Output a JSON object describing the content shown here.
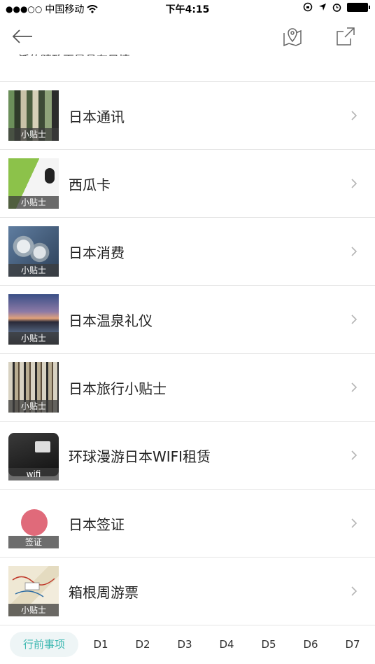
{
  "status_bar": {
    "signal": "●●●○○",
    "carrier": "中国移动",
    "time": "下午4:15"
  },
  "header": {
    "cutoff_text": "活的精致更是具有风情。"
  },
  "list": [
    {
      "title": "日本通讯",
      "badge": "小贴士"
    },
    {
      "title": "西瓜卡",
      "badge": "小贴士"
    },
    {
      "title": "日本消费",
      "badge": "小贴士"
    },
    {
      "title": "日本温泉礼仪",
      "badge": "小贴士"
    },
    {
      "title": "日本旅行小贴士",
      "badge": "小贴士"
    },
    {
      "title": "环球漫游日本WIFI租赁",
      "badge": "wifi"
    },
    {
      "title": "日本签证",
      "badge": "签证"
    },
    {
      "title": "箱根周游票",
      "badge": "小贴士"
    }
  ],
  "tabs": [
    "行前事项",
    "D1",
    "D2",
    "D3",
    "D4",
    "D5",
    "D6",
    "D7"
  ],
  "colors": {
    "accent": "#3bb7b0",
    "tab_active_bg": "#eef5f6",
    "visa_dot": "#e06a7a"
  }
}
